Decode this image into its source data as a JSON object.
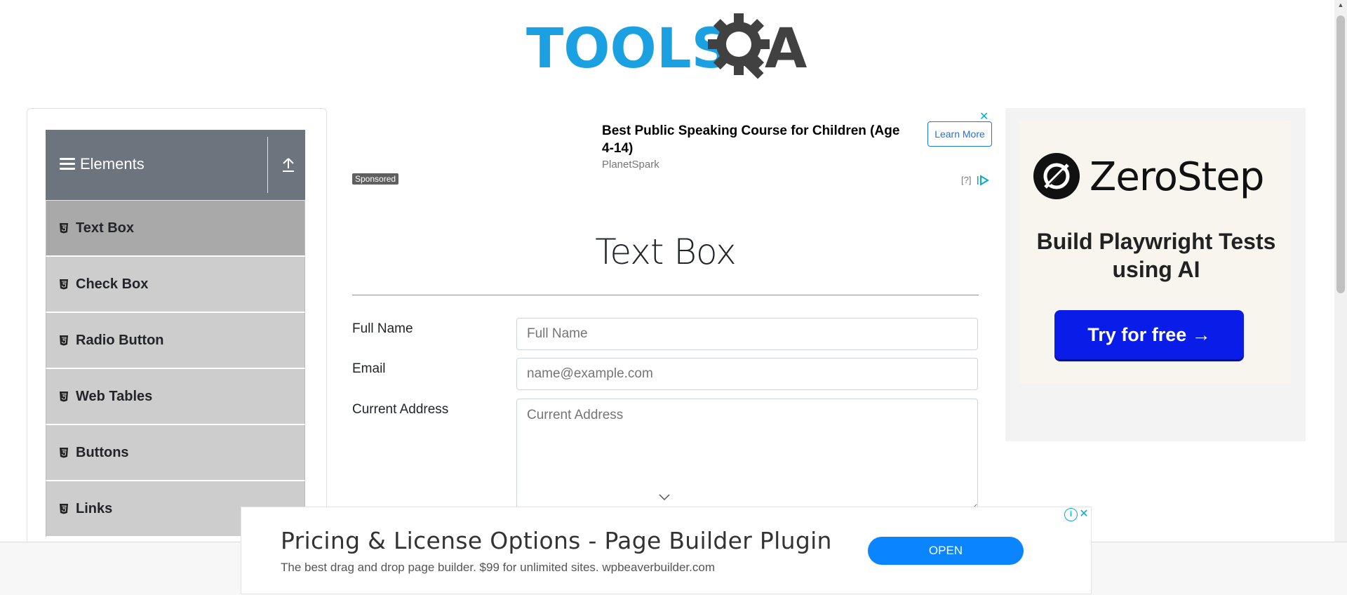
{
  "logo": {
    "part1": "TOOLS",
    "part2": "A"
  },
  "sidebar": {
    "group_title": "Elements",
    "items": [
      {
        "label": "Text Box",
        "active": true
      },
      {
        "label": "Check Box"
      },
      {
        "label": "Radio Button"
      },
      {
        "label": "Web Tables"
      },
      {
        "label": "Buttons"
      },
      {
        "label": "Links"
      }
    ]
  },
  "top_ad": {
    "headline": "Best Public Speaking Course for Children (Age 4-14)",
    "source": "PlanetSpark",
    "cta": "Learn More",
    "sponsored": "Sponsored",
    "choices": "[?]",
    "close": "✕"
  },
  "main": {
    "title": "Text Box",
    "fields": {
      "full_name": {
        "label": "Full Name",
        "placeholder": "Full Name"
      },
      "email": {
        "label": "Email",
        "placeholder": "name@example.com"
      },
      "current_address": {
        "label": "Current Address",
        "placeholder": "Current Address"
      }
    }
  },
  "right_ad": {
    "brand": "ZeroStep",
    "tagline": "Build Playwright Tests using AI",
    "cta": "Try for free →"
  },
  "bottom_ad": {
    "headline": "Pricing & License Options - Page Builder Plugin",
    "description": "The best drag and drop page builder. $99 for unlimited sites. wpbeaverbuilder.com",
    "cta": "OPEN",
    "info": "i",
    "close": "✕"
  },
  "colors": {
    "logo_blue": "#1ba1e2",
    "logo_dark": "#414141",
    "sidebar_header": "#6c757d",
    "menu_item": "#cdcdcd",
    "menu_item_active": "#a9a9a9",
    "ad_accent": "#00aecd",
    "zerostep_cta": "#0a1de8",
    "open_button": "#0a84ff"
  },
  "icons": [
    "gear-magnifier-logo-icon",
    "hamburger-icon",
    "upload-icon",
    "html5-icon",
    "chevron-down-icon",
    "adchoices-icon",
    "info-icon",
    "close-icon",
    "zerostep-logo-icon"
  ]
}
